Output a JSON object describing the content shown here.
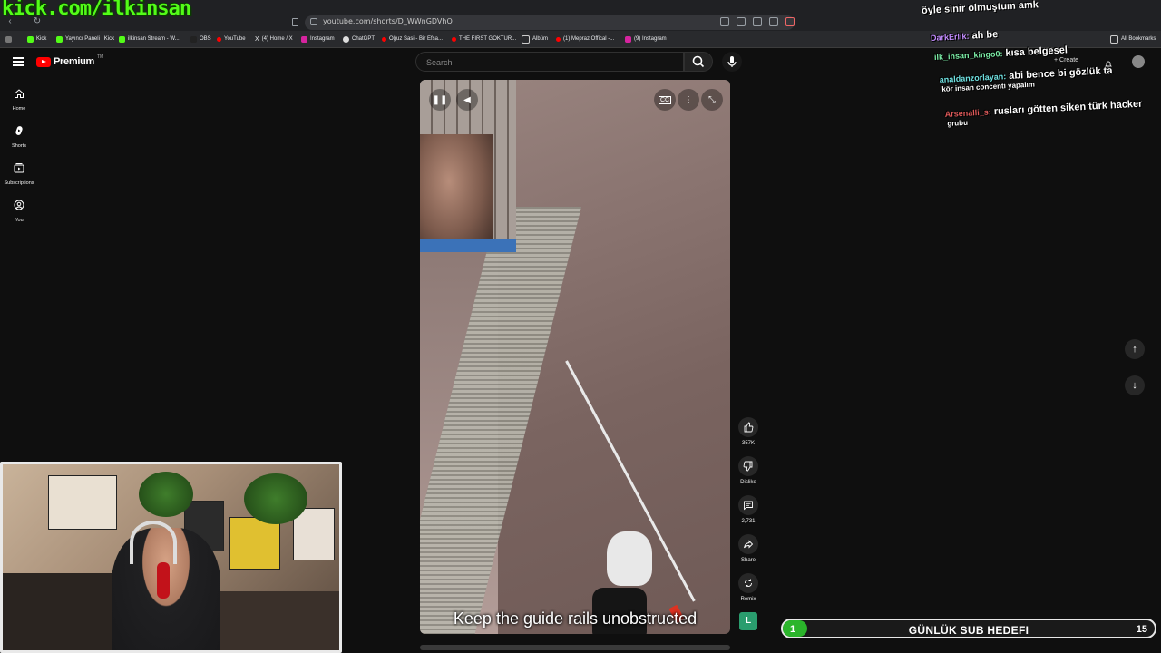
{
  "browser": {
    "url": "youtube.com/shorts/D_WWnGDVhQ",
    "bookmarks": [
      "Kick",
      "Yayıncı Paneli | Kick",
      "ilkinsan Stream - W...",
      "OBS",
      "YouTube",
      "(4) Home / X",
      "Instagram",
      "ChatGPT",
      "Oğuz Sasi - Bir Efsa...",
      "THE FIRST GOKTUR...",
      "Albüm",
      "(1) Mepraz Offical -...",
      "(9) Instagram"
    ],
    "all_bookmarks_label": "All Bookmarks"
  },
  "watermark": "kick.com/ilkinsan",
  "youtube": {
    "logo_text": "Premium",
    "logo_tm": "TM",
    "search_placeholder": "Search",
    "create_label": "Create",
    "guide": [
      {
        "label": "Home",
        "icon": "home-icon"
      },
      {
        "label": "Shorts",
        "icon": "shorts-icon"
      },
      {
        "label": "Subscriptions",
        "icon": "subscriptions-icon"
      },
      {
        "label": "You",
        "icon": "you-icon"
      }
    ],
    "caption": "Keep the guide rails unobstructed",
    "actions": [
      {
        "label": "357K",
        "icon": "like-icon"
      },
      {
        "label": "Dislike",
        "icon": "dislike-icon"
      },
      {
        "label": "2,731",
        "icon": "comment-icon"
      },
      {
        "label": "Share",
        "icon": "share-icon"
      },
      {
        "label": "Remix",
        "icon": "remix-icon"
      }
    ],
    "channel_avatar": "L"
  },
  "chat": [
    {
      "user": "",
      "message": "öyle sinir olmuştum amk"
    },
    {
      "user": "DarkErlik:",
      "message": "ah be"
    },
    {
      "user": "ilk_insan_kingo0:",
      "message": "kısa belgesel"
    },
    {
      "user": "analdanzorlayan:",
      "message": "abi bence bi gözlük ta",
      "continuation": "kör insan concenti yapalım"
    },
    {
      "user": "Arsenalli_s:",
      "message": "rusları götten siken türk hacker",
      "continuation": "grubu"
    }
  ],
  "sub_goal": {
    "title": "GÜNLÜK SUB HEDEFI",
    "current": "1",
    "target": "15",
    "progress_fraction": 0.067,
    "fill_color": "#2bb52b"
  }
}
